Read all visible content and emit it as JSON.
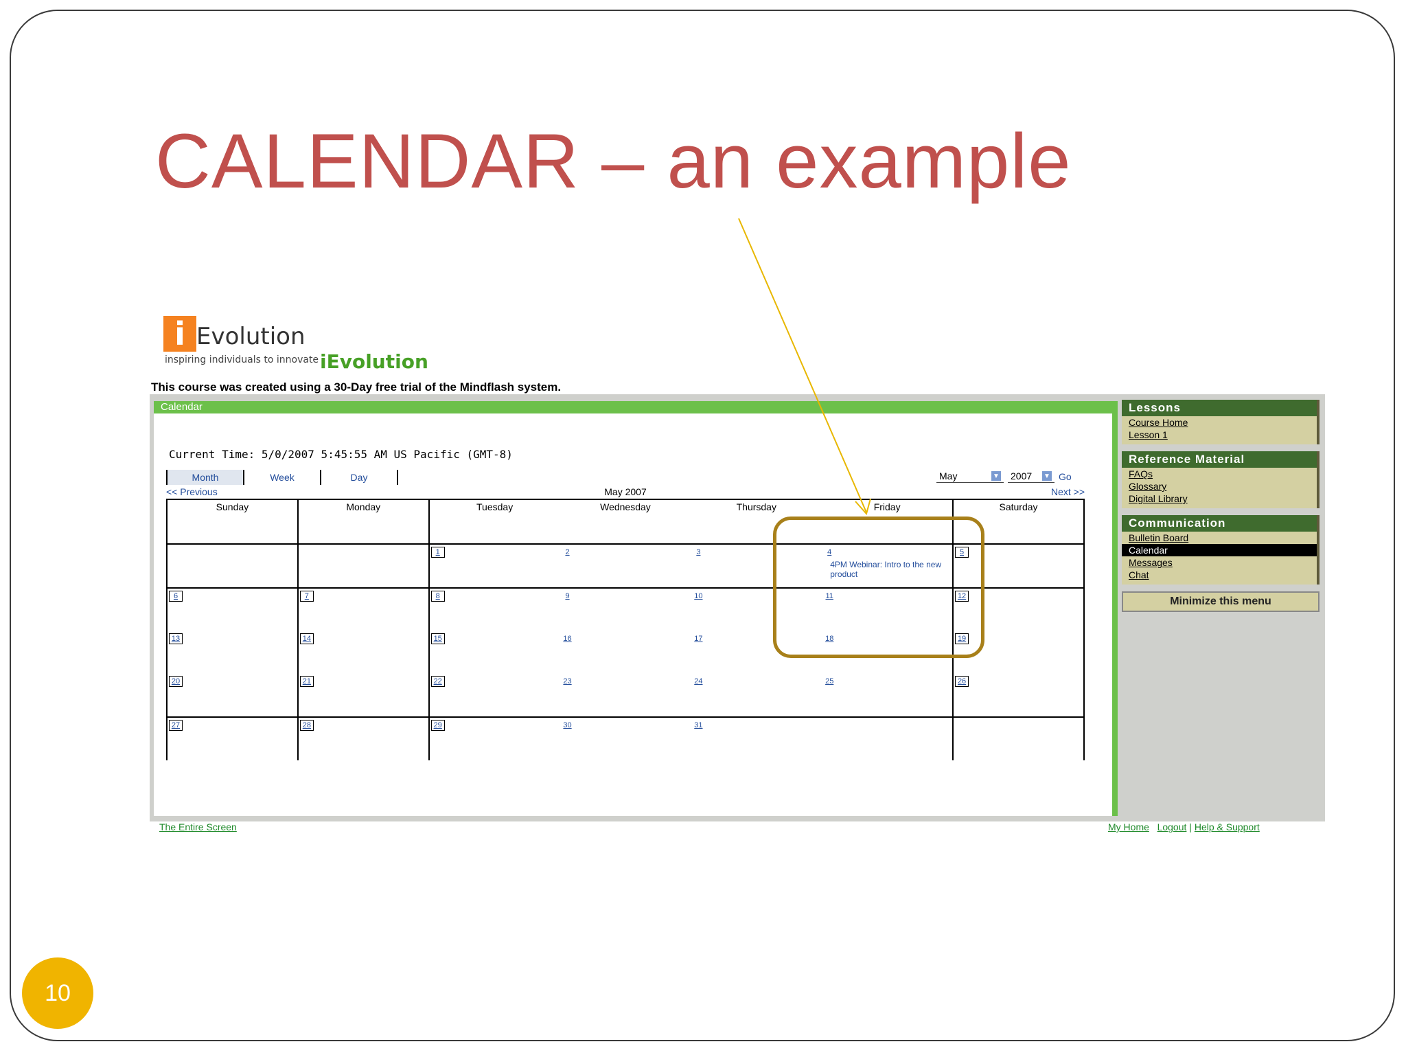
{
  "slide": {
    "title": "CALENDAR – an example",
    "page_number": "10"
  },
  "logo": {
    "letter": "i",
    "word": "Evolution",
    "tagline": "inspiring individuals to innovate",
    "green_text": "iEvolution"
  },
  "trial_note": "This course was created using a 30-Day free trial of the Mindflash system.",
  "calendar": {
    "header": "Calendar",
    "current_time": "Current Time: 5/0/2007 5:45:55 AM US Pacific (GMT-8)",
    "view_tabs": [
      "Month",
      "Week",
      "Day"
    ],
    "month_value": "May",
    "year_value": "2007",
    "go_label": "Go",
    "prev_label": "<< Previous",
    "month_title": "May 2007",
    "next_label": "Next >>",
    "weekdays": [
      "Sunday",
      "Monday",
      "Tuesday",
      "Wednesday",
      "Thursday",
      "Friday",
      "Saturday"
    ],
    "weeks": [
      [
        "",
        "",
        "1",
        "2",
        "3",
        "4",
        "5"
      ],
      [
        "6",
        "7",
        "8",
        "9",
        "10",
        "11",
        "12"
      ],
      [
        "13",
        "14",
        "15",
        "16",
        "17",
        "18",
        "19"
      ],
      [
        "20",
        "21",
        "22",
        "23",
        "24",
        "25",
        "26"
      ],
      [
        "27",
        "28",
        "29",
        "30",
        "31",
        "",
        ""
      ]
    ],
    "event_text": "4PM Webinar: Intro to the new product"
  },
  "sidebar": {
    "lessons_head": "Lessons",
    "lessons": [
      "Course Home",
      "Lesson 1"
    ],
    "reference_head": "Reference Material",
    "reference": [
      "FAQs",
      "Glossary",
      "Digital Library"
    ],
    "communication_head": "Communication",
    "communication": [
      "Bulletin Board",
      "Calendar",
      "Messages",
      "Chat"
    ],
    "minimize_label": "Minimize this menu"
  },
  "footer": {
    "left": "The Entire Screen",
    "home": "My Home",
    "logout": "Logout",
    "help": "Help & Support"
  },
  "colors": {
    "title": "#c0504d",
    "page_badge": "#f0b400",
    "highlight": "#a8801a",
    "arrow": "#e8b700",
    "header_green": "#6cc04a",
    "side_head": "#3f6b2e"
  }
}
